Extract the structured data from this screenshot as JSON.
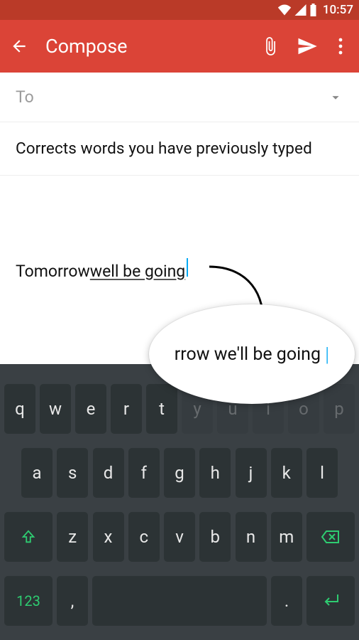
{
  "status": {
    "time": "10:57"
  },
  "appbar": {
    "title": "Compose"
  },
  "compose": {
    "to_label": "To",
    "subject": "Corrects words you have previously typed",
    "body_plain": "Tomorrow ",
    "body_underlined": "well be going",
    "callout_text": "rrow we'll be going "
  },
  "keyboard": {
    "row1": [
      "q",
      "w",
      "e",
      "r",
      "t",
      "y",
      "u",
      "i",
      "o",
      "p"
    ],
    "row2": [
      "a",
      "s",
      "d",
      "f",
      "g",
      "h",
      "j",
      "k",
      "l"
    ],
    "row3": [
      "z",
      "x",
      "c",
      "v",
      "b",
      "n",
      "m"
    ],
    "sym": "123",
    "comma": ",",
    "period": "."
  }
}
